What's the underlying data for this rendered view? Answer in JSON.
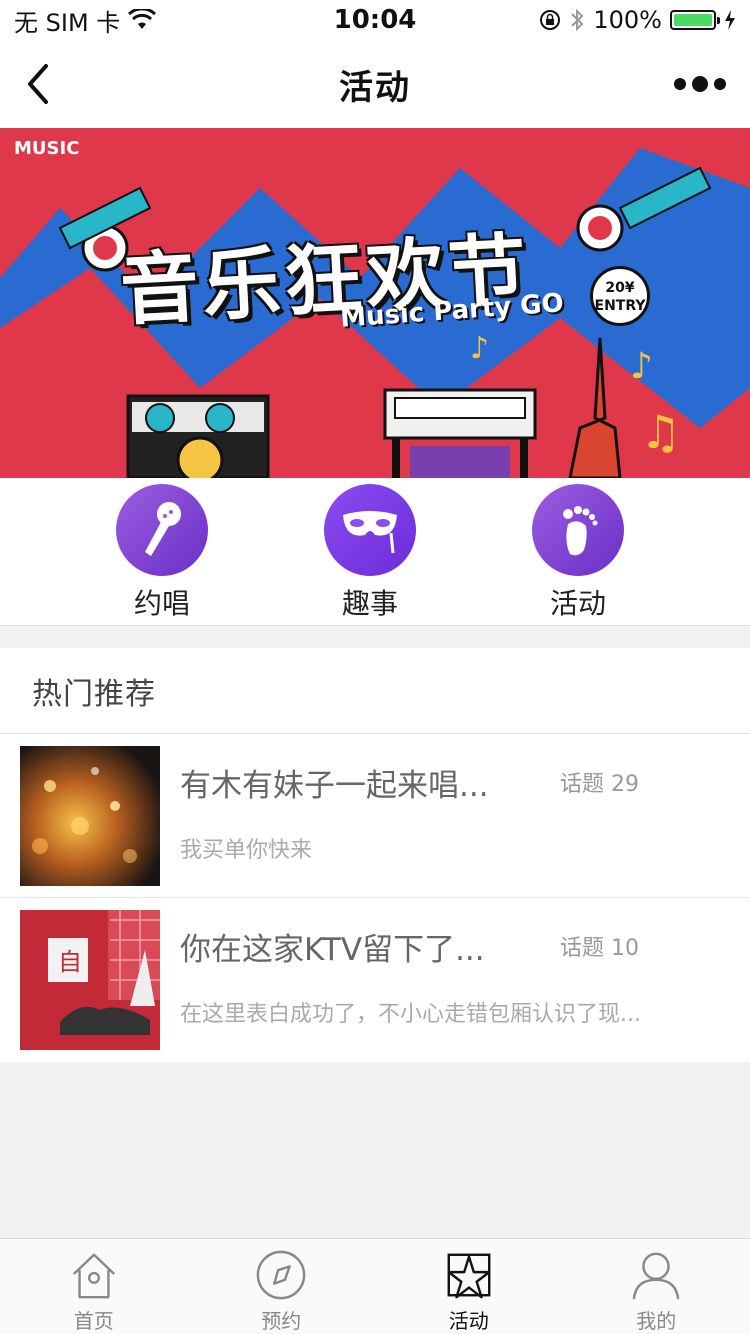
{
  "status": {
    "carrier": "无 SIM 卡",
    "time": "10:04",
    "battery": "100%"
  },
  "nav": {
    "title": "活动"
  },
  "banner": {
    "brand": "MUSIC",
    "title": "音乐狂欢节",
    "subtitle": "Music Party GO",
    "badge": "20¥ ENTRY"
  },
  "quick_actions": [
    {
      "label": "约唱",
      "icon": "microphone-icon"
    },
    {
      "label": "趣事",
      "icon": "mask-icon"
    },
    {
      "label": "活动",
      "icon": "footprint-icon"
    }
  ],
  "hot": {
    "header": "热门推荐",
    "posts": [
      {
        "title": "有木有妹子一起来唱...",
        "count": "话题 29",
        "desc": "我买单你快来"
      },
      {
        "title": "你在这家KTV留下了...",
        "count": "话题 10",
        "desc": "在这里表白成功了，不小心走错包厢认识了现..."
      }
    ]
  },
  "tabs": [
    {
      "label": "首页",
      "icon": "home-icon"
    },
    {
      "label": "预约",
      "icon": "compass-icon"
    },
    {
      "label": "活动",
      "icon": "star-icon"
    },
    {
      "label": "我的",
      "icon": "user-icon"
    }
  ],
  "colors": {
    "accent": "#7b3fd6",
    "battery": "#4cd964",
    "banner_red": "#e0384b",
    "banner_blue": "#2a6bd1"
  }
}
